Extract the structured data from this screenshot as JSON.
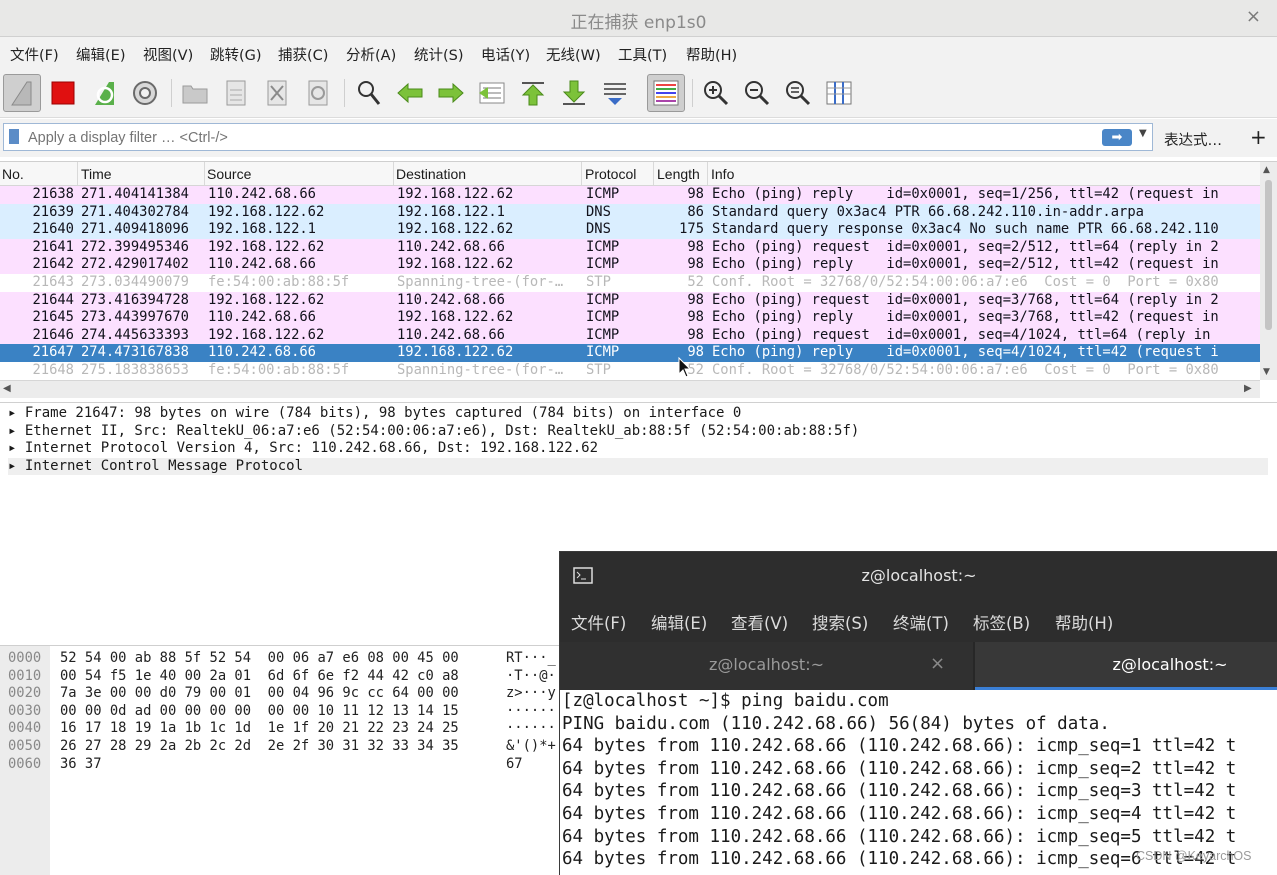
{
  "window": {
    "title": "正在捕获 enp1s0",
    "close_glyph": "×"
  },
  "menu": [
    "文件(F)",
    "编辑(E)",
    "视图(V)",
    "跳转(G)",
    "捕获(C)",
    "分析(A)",
    "统计(S)",
    "电话(Y)",
    "无线(W)",
    "工具(T)",
    "帮助(H)"
  ],
  "toolbar_icons": [
    "start-capture-icon",
    "stop-capture-icon",
    "restart-capture-icon",
    "capture-options-icon",
    "open-file-icon",
    "save-file-icon",
    "close-file-icon",
    "reload-file-icon",
    "find-packet-icon",
    "go-back-icon",
    "go-forward-icon",
    "go-to-packet-icon",
    "go-first-icon",
    "go-last-icon",
    "auto-scroll-icon",
    "colorize-icon",
    "zoom-in-icon",
    "zoom-out-icon",
    "normal-size-icon",
    "resize-columns-icon"
  ],
  "filter": {
    "placeholder": "Apply a display filter … <Ctrl-/>",
    "expression_label": "表达式…",
    "add_label": "+"
  },
  "columns": [
    "No.",
    "Time",
    "Source",
    "Destination",
    "Protocol",
    "Length",
    "Info"
  ],
  "packets": [
    {
      "no": "21638",
      "time": "271.404141384",
      "src": "110.242.68.66",
      "dst": "192.168.122.62",
      "proto": "ICMP",
      "len": "98",
      "info": "Echo (ping) reply    id=0x0001, seq=1/256, ttl=42 (request in",
      "kind": "icmp"
    },
    {
      "no": "21639",
      "time": "271.404302784",
      "src": "192.168.122.62",
      "dst": "192.168.122.1",
      "proto": "DNS",
      "len": "86",
      "info": "Standard query 0x3ac4 PTR 66.68.242.110.in-addr.arpa",
      "kind": "dns"
    },
    {
      "no": "21640",
      "time": "271.409418096",
      "src": "192.168.122.1",
      "dst": "192.168.122.62",
      "proto": "DNS",
      "len": "175",
      "info": "Standard query response 0x3ac4 No such name PTR 66.68.242.110",
      "kind": "dns"
    },
    {
      "no": "21641",
      "time": "272.399495346",
      "src": "192.168.122.62",
      "dst": "110.242.68.66",
      "proto": "ICMP",
      "len": "98",
      "info": "Echo (ping) request  id=0x0001, seq=2/512, ttl=64 (reply in 2",
      "kind": "icmp"
    },
    {
      "no": "21642",
      "time": "272.429017402",
      "src": "110.242.68.66",
      "dst": "192.168.122.62",
      "proto": "ICMP",
      "len": "98",
      "info": "Echo (ping) reply    id=0x0001, seq=2/512, ttl=42 (request in",
      "kind": "icmp"
    },
    {
      "no": "21643",
      "time": "273.034490079",
      "src": "fe:54:00:ab:88:5f",
      "dst": "Spanning-tree-(for-…",
      "proto": "STP",
      "len": "52",
      "info": "Conf. Root = 32768/0/52:54:00:06:a7:e6  Cost = 0  Port = 0x80",
      "kind": "stp"
    },
    {
      "no": "21644",
      "time": "273.416394728",
      "src": "192.168.122.62",
      "dst": "110.242.68.66",
      "proto": "ICMP",
      "len": "98",
      "info": "Echo (ping) request  id=0x0001, seq=3/768, ttl=64 (reply in 2",
      "kind": "icmp"
    },
    {
      "no": "21645",
      "time": "273.443997670",
      "src": "110.242.68.66",
      "dst": "192.168.122.62",
      "proto": "ICMP",
      "len": "98",
      "info": "Echo (ping) reply    id=0x0001, seq=3/768, ttl=42 (request in",
      "kind": "icmp"
    },
    {
      "no": "21646",
      "time": "274.445633393",
      "src": "192.168.122.62",
      "dst": "110.242.68.66",
      "proto": "ICMP",
      "len": "98",
      "info": "Echo (ping) request  id=0x0001, seq=4/1024, ttl=64 (reply in",
      "kind": "icmp"
    },
    {
      "no": "21647",
      "time": "274.473167838",
      "src": "110.242.68.66",
      "dst": "192.168.122.62",
      "proto": "ICMP",
      "len": "98",
      "info": "Echo (ping) reply    id=0x0001, seq=4/1024, ttl=42 (request i",
      "kind": "sel"
    },
    {
      "no": "21648",
      "time": "275.183838653",
      "src": "fe:54:00:ab:88:5f",
      "dst": "Spanning-tree-(for-…",
      "proto": "STP",
      "len": "52",
      "info": "Conf. Root = 32768/0/52:54:00:06:a7:e6  Cost = 0  Port = 0x80",
      "kind": "stp"
    }
  ],
  "details": [
    "Frame 21647: 98 bytes on wire (784 bits), 98 bytes captured (784 bits) on interface 0",
    "Ethernet II, Src: RealtekU_06:a7:e6 (52:54:00:06:a7:e6), Dst: RealtekU_ab:88:5f (52:54:00:ab:88:5f)",
    "Internet Protocol Version 4, Src: 110.242.68.66, Dst: 192.168.122.62",
    "Internet Control Message Protocol"
  ],
  "hex": [
    {
      "off": "0000",
      "bytes": "52 54 00 ab 88 5f 52 54  00 06 a7 e6 08 00 45 00",
      "ascii": "RT···_"
    },
    {
      "off": "0010",
      "bytes": "00 54 f5 1e 40 00 2a 01  6d 6f 6e f2 44 42 c0 a8",
      "ascii": "·T··@·"
    },
    {
      "off": "0020",
      "bytes": "7a 3e 00 00 d0 79 00 01  00 04 96 9c cc 64 00 00",
      "ascii": "z>···y"
    },
    {
      "off": "0030",
      "bytes": "00 00 0d ad 00 00 00 00  00 00 10 11 12 13 14 15",
      "ascii": "······"
    },
    {
      "off": "0040",
      "bytes": "16 17 18 19 1a 1b 1c 1d  1e 1f 20 21 22 23 24 25",
      "ascii": "······"
    },
    {
      "off": "0050",
      "bytes": "26 27 28 29 2a 2b 2c 2d  2e 2f 30 31 32 33 34 35",
      "ascii": "&'()*+"
    },
    {
      "off": "0060",
      "bytes": "36 37",
      "ascii": "67"
    }
  ],
  "terminal": {
    "title": "z@localhost:~",
    "menu": [
      "文件(F)",
      "编辑(E)",
      "查看(V)",
      "搜索(S)",
      "终端(T)",
      "标签(B)",
      "帮助(H)"
    ],
    "tabs": [
      "z@localhost:~",
      "z@localhost:~"
    ],
    "tab_close": "×",
    "lines": [
      "[z@localhost ~]$ ping baidu.com",
      "PING baidu.com (110.242.68.66) 56(84) bytes of data.",
      "64 bytes from 110.242.68.66 (110.242.68.66): icmp_seq=1 ttl=42 t",
      "64 bytes from 110.242.68.66 (110.242.68.66): icmp_seq=2 ttl=42 t",
      "64 bytes from 110.242.68.66 (110.242.68.66): icmp_seq=3 ttl=42 t",
      "64 bytes from 110.242.68.66 (110.242.68.66): icmp_seq=4 ttl=42 t",
      "64 bytes from 110.242.68.66 (110.242.68.66): icmp_seq=5 ttl=42 t",
      "64 bytes from 110.242.68.66 (110.242.68.66): icmp_seq=6 ttl=42 t"
    ]
  },
  "watermark": "CSDN @KeyarchOS",
  "colors": {
    "icmp_row": "#fce0ff",
    "dns_row": "#daeeff",
    "selected_row": "#3a82c4",
    "terminal_tab_accent": "#3a7fd6"
  }
}
